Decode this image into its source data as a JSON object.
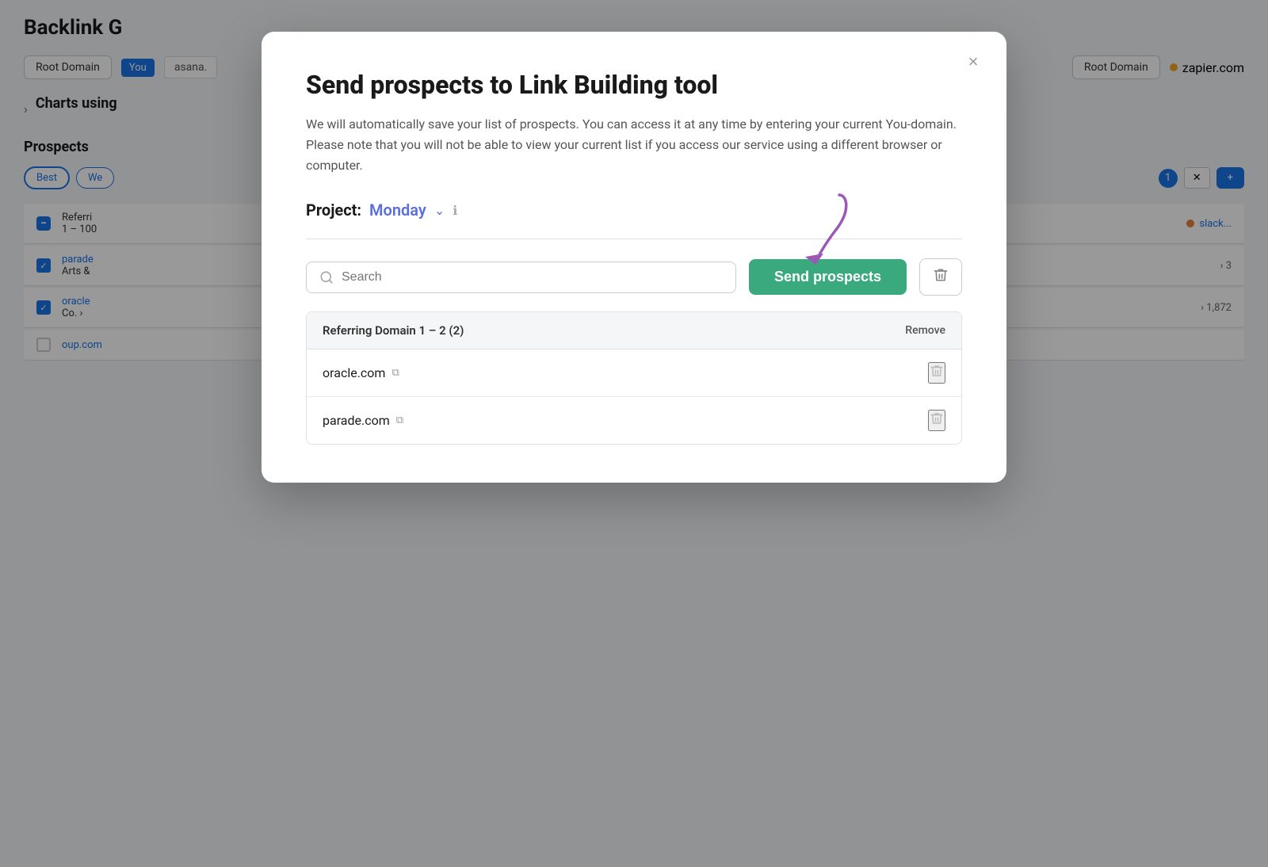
{
  "bg": {
    "title": "Backlink G",
    "root_domain_label": "Root Domain",
    "you_tag": "You",
    "asana_domain": "asana.",
    "root_domain_right": "Root Domain",
    "zapier_domain": "zapier.com",
    "charts_label": "Charts using",
    "prospects_label": "Prospects",
    "filter_best": "Best",
    "filter_we": "We",
    "slack_domain": "slack...",
    "parade_domain": "parade",
    "arts_sub": "Arts &",
    "oracle_domain": "oracle",
    "co_sub": "Co. >",
    "oup_domain": "oup.com",
    "number_1": "1,872",
    "add_btn": "+",
    "x_badge": "1"
  },
  "modal": {
    "title": "Send prospects to Link Building tool",
    "description": "We will automatically save your list of prospects. You can access it at any time by entering your current You-domain. Please note that you will not be able to view your current list if you access our service using a different browser or computer.",
    "project_label": "Project:",
    "project_value": "Monday",
    "close_label": "×",
    "search_placeholder": "Search",
    "send_button_label": "Send prospects",
    "delete_button_label": "🗑",
    "prospects_header_label": "Referring Domain 1 – 2 (2)",
    "prospects_header_remove": "Remove",
    "prospects": [
      {
        "domain": "oracle.com"
      },
      {
        "domain": "parade.com"
      }
    ]
  }
}
